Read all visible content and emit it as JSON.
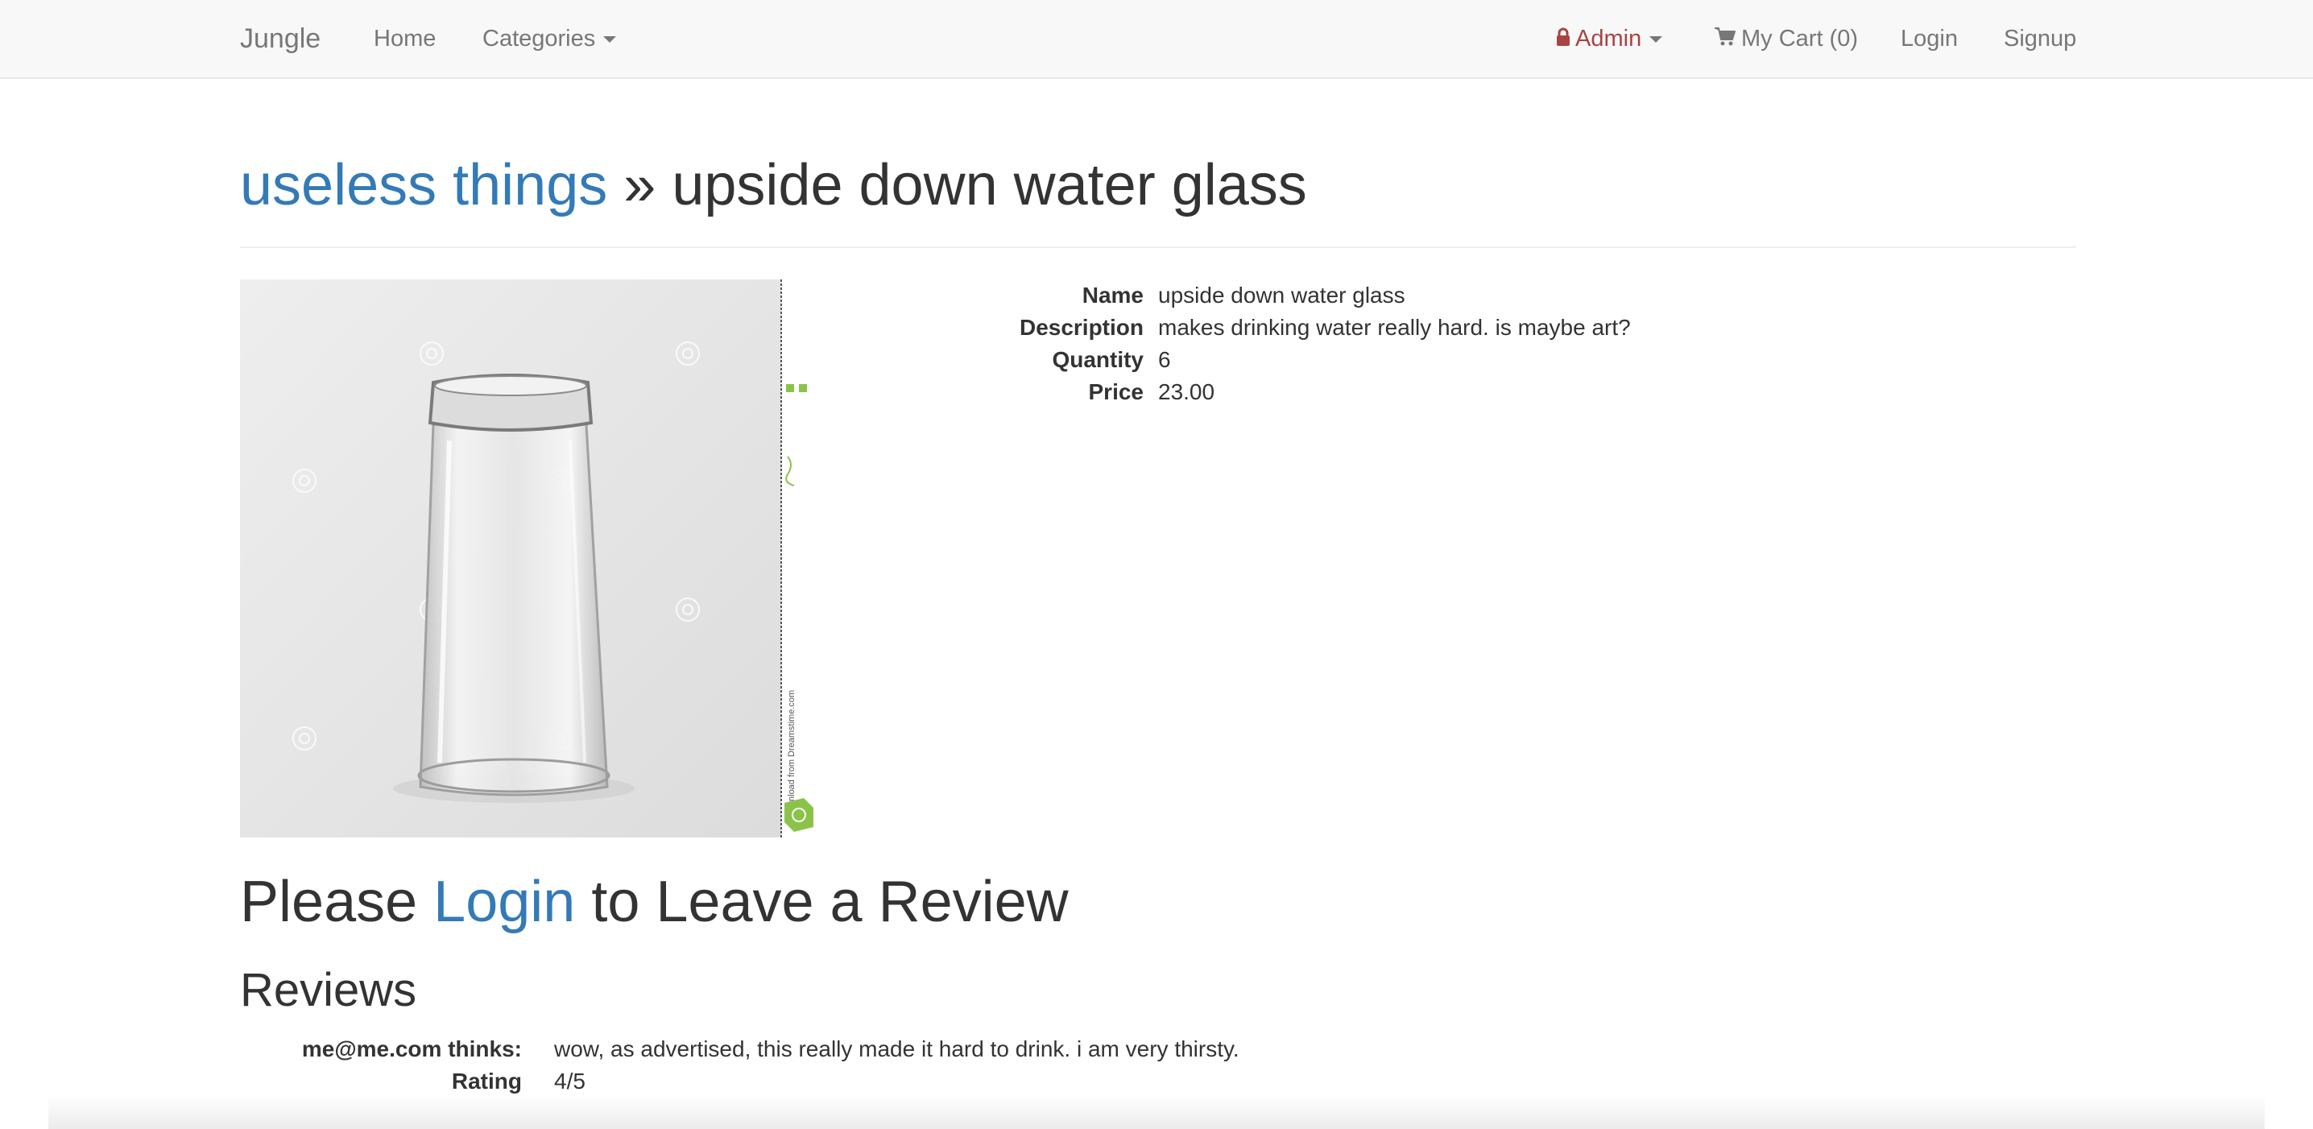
{
  "navbar": {
    "brand": "Jungle",
    "home_label": "Home",
    "categories_label": "Categories",
    "admin_label": "Admin",
    "cart_label": "My Cart (0)",
    "login_label": "Login",
    "signup_label": "Signup"
  },
  "header": {
    "category_link": "useless things",
    "separator": " » ",
    "product_name": "upside down water glass"
  },
  "product": {
    "details": [
      {
        "label": "Name",
        "value": "upside down water glass"
      },
      {
        "label": "Description",
        "value": "makes drinking water really hard. is maybe art?"
      },
      {
        "label": "Quantity",
        "value": "6"
      },
      {
        "label": "Price",
        "value": "23.00"
      }
    ],
    "image_caption_text": "Download from Dreamstime.com"
  },
  "review_prompt": {
    "prefix": "Please ",
    "link": "Login",
    "suffix": " to Leave a Review"
  },
  "reviews": {
    "heading": "Reviews",
    "items": [
      {
        "author_label": "me@me.com thinks:",
        "text": "wow, as advertised, this really made it hard to drink. i am very thirsty.",
        "rating_label": "Rating",
        "rating": "4/5"
      }
    ]
  },
  "colors": {
    "link": "#337ab7",
    "admin": "#a94442",
    "navbar_bg": "#f8f8f8",
    "text": "#333333"
  }
}
